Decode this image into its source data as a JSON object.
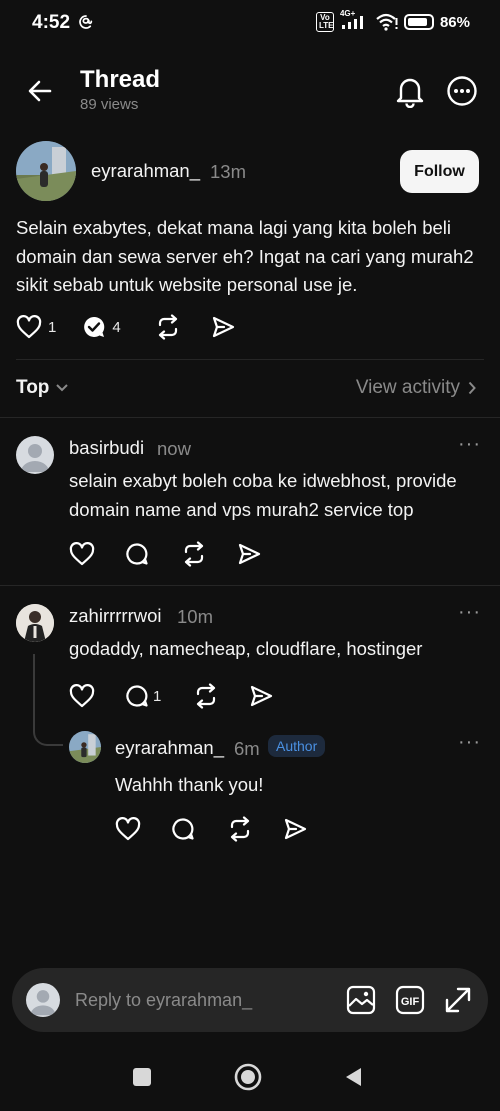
{
  "status_bar": {
    "time": "4:52",
    "volte": "Vo LTE",
    "network": "4G+",
    "battery": "86%",
    "battery_level": 0.86
  },
  "header": {
    "title": "Thread",
    "views": "89 views"
  },
  "post": {
    "username": "eyrarahman_",
    "time": "13m",
    "follow_label": "Follow",
    "text": "Selain exabytes, dekat mana lagi yang kita boleh beli domain dan sewa server eh? Ingat na cari yang murah2 sikit sebab untuk website personal use je.",
    "likes": "1",
    "replies": "4"
  },
  "sort": {
    "label": "Top",
    "view_activity": "View activity"
  },
  "comments": [
    {
      "username": "basirbudi",
      "time": "now",
      "text": "selain exabyt boleh coba ke idwebhost, provide domain name and vps murah2 service top"
    },
    {
      "username": "zahirrrrrwoi",
      "time": "10m",
      "text": "godaddy, namecheap, cloudflare, hostinger",
      "replies": "1"
    },
    {
      "username": "eyrarahman_",
      "time": "6m",
      "badge": "Author",
      "text": "Wahhh thank you!"
    }
  ],
  "reply_bar": {
    "placeholder": "Reply to eyrarahman_"
  }
}
